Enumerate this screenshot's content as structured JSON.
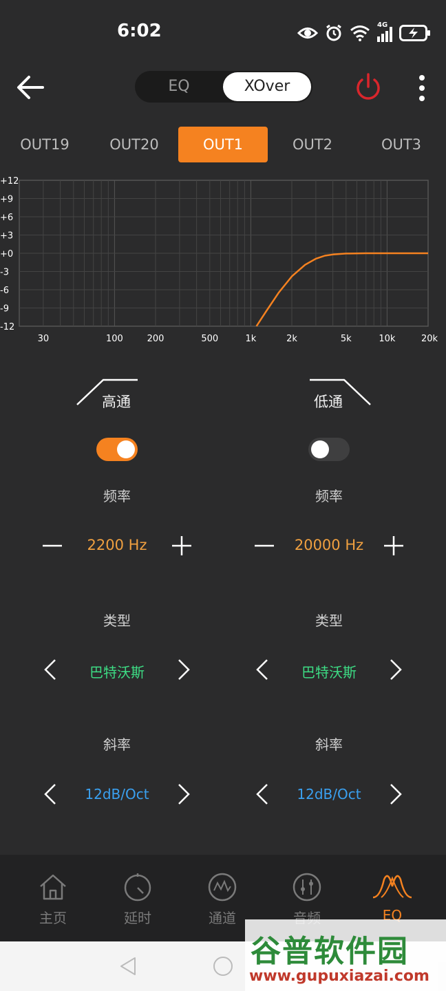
{
  "status": {
    "time": "6:02",
    "network": "4G"
  },
  "header": {
    "segments": [
      "EQ",
      "XOver"
    ],
    "active_segment": "XOver"
  },
  "tabs": [
    "OUT19",
    "OUT20",
    "OUT1",
    "OUT2",
    "OUT3"
  ],
  "active_tab": "OUT1",
  "chart_data": {
    "type": "line",
    "title": "",
    "xlabel": "",
    "ylabel": "",
    "x_scale": "log",
    "xlim": [
      20,
      20000
    ],
    "ylim": [
      -12,
      12
    ],
    "y_ticks": [
      "+12",
      "+9",
      "+6",
      "+3",
      "+0",
      "-3",
      "-6",
      "-9",
      "-12"
    ],
    "x_ticks": [
      "30",
      "100",
      "200",
      "500",
      "1k",
      "2k",
      "5k",
      "10k",
      "20k"
    ],
    "grid": true,
    "series": [
      {
        "color": "#f58220",
        "x": [
          1100,
          1300,
          1600,
          2000,
          2500,
          3000,
          3500,
          4000,
          5000,
          7000,
          10000,
          20000
        ],
        "y": [
          -12,
          -9.5,
          -6.5,
          -3.8,
          -1.9,
          -0.9,
          -0.4,
          -0.2,
          -0.05,
          0,
          0,
          0
        ]
      }
    ]
  },
  "highpass": {
    "title": "高通",
    "enabled": true,
    "freq_label": "频率",
    "freq_value": "2200 Hz",
    "type_label": "类型",
    "type_value": "巴特沃斯",
    "slope_label": "斜率",
    "slope_value": "12dB/Oct"
  },
  "lowpass": {
    "title": "低通",
    "enabled": false,
    "freq_label": "频率",
    "freq_value": "20000 Hz",
    "type_label": "类型",
    "type_value": "巴特沃斯",
    "slope_label": "斜率",
    "slope_value": "12dB/Oct"
  },
  "nav": {
    "items": [
      "主页",
      "延时",
      "通道",
      "音频",
      "EQ"
    ],
    "active": "EQ"
  },
  "watermark": {
    "title": "谷普软件园",
    "url": "www.gupuxiazai.com"
  },
  "colors": {
    "accent": "#f58220",
    "background": "#2b2b2c",
    "power": "#d9262c"
  }
}
